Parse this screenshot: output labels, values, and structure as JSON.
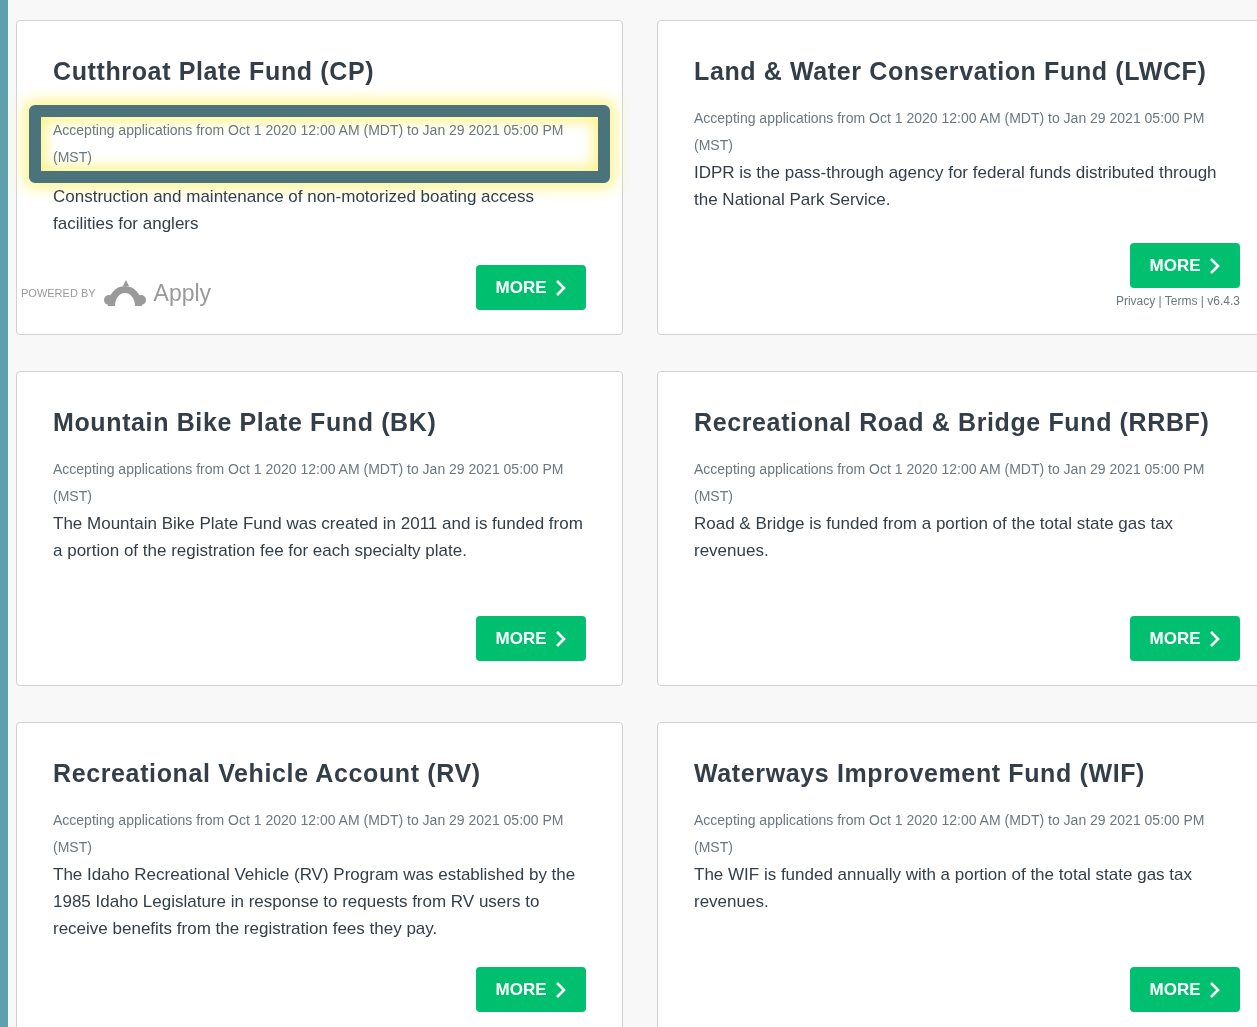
{
  "funds": [
    {
      "title": "Cutthroat Plate Fund (CP)",
      "dates": "Accepting applications from Oct 1 2020 12:00 AM (MDT) to Jan 29 2021 05:00 PM (MST)",
      "description": "Construction and maintenance of non-motorized boating access facilities for anglers",
      "button": "MORE",
      "highlighted": true
    },
    {
      "title": "Land & Water Conservation Fund (LWCF)",
      "dates": "Accepting applications from Oct 1 2020 12:00 AM (MDT) to Jan 29 2021 05:00 PM (MST)",
      "description": "IDPR is the pass-through agency for federal funds distributed through the National Park Service.",
      "button": "MORE",
      "highlighted": false
    },
    {
      "title": "Mountain Bike Plate Fund (BK)",
      "dates": "Accepting applications from Oct 1 2020 12:00 AM (MDT) to Jan 29 2021 05:00 PM (MST)",
      "description": "The Mountain Bike Plate Fund was created in 2011 and is funded from a portion of the registration fee for each specialty plate.",
      "button": "MORE",
      "highlighted": false
    },
    {
      "title": "Recreational Road & Bridge Fund (RRBF)",
      "dates": "Accepting applications from Oct 1 2020 12:00 AM (MDT) to Jan 29 2021 05:00 PM (MST)",
      "description": "Road & Bridge is funded from a portion of the total state gas tax revenues.",
      "button": "MORE",
      "highlighted": false
    },
    {
      "title": "Recreational Vehicle Account (RV)",
      "dates": "Accepting applications from Oct 1 2020 12:00 AM (MDT) to Jan 29 2021 05:00 PM (MST)",
      "description": "The Idaho Recreational Vehicle (RV) Program was established by the 1985 Idaho Legislature in response to requests from RV users to receive benefits from the registration fees they pay.",
      "button": "MORE",
      "highlighted": false
    },
    {
      "title": "Waterways Improvement Fund (WIF)",
      "dates": "Accepting applications from Oct 1 2020 12:00 AM (MDT) to Jan 29 2021 05:00 PM (MST)",
      "description": "The WIF is funded annually with a portion of the total state gas tax revenues.",
      "button": "MORE",
      "highlighted": false
    }
  ],
  "footer": {
    "powered_by": "POWERED BY",
    "logo": "Apply",
    "links": "Privacy | Terms | v6.4.3"
  }
}
